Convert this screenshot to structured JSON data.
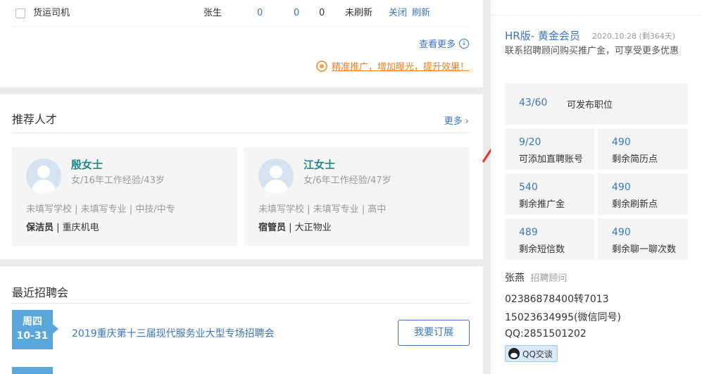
{
  "jobs": {
    "row": {
      "title": "货运司机",
      "contact": "张生",
      "n1": "0",
      "n2": "0",
      "n3": "0",
      "refresh_status": "未刷新",
      "action_close": "关闭",
      "action_refresh": "刷新"
    },
    "more_label": "查看更多",
    "promo_text": "精准推广，增加曝光，提升效果！"
  },
  "talent": {
    "title": "推荐人才",
    "more_label": "更多",
    "cards": [
      {
        "name": "殷女士",
        "info": "女/16年工作经验/43岁",
        "edu": "未填写学校 | 未填写专业 | 中技/中专",
        "job": "保洁员",
        "company": "| 重庆机电"
      },
      {
        "name": "江女士",
        "info": "女/6年工作经验/47岁",
        "edu": "未填写学校 | 未填写专业 | 高中",
        "job": "宿管员",
        "company": "| 大正物业"
      }
    ]
  },
  "fairs": {
    "title": "最近招聘会",
    "items": [
      {
        "weekday": "周四",
        "date": "10-31",
        "name": "2019重庆第十三届现代服务业大型专场招聘会",
        "button": "我要订展"
      }
    ]
  },
  "account": {
    "plan": "HR版- 黄金会员",
    "plan_date": "2020.10.28 (剩364天)",
    "desc": "联系招聘顾问购买推广金，可享受更多优惠",
    "positions": {
      "value": "43/60",
      "label": "可发布职位"
    },
    "stats": [
      {
        "value": "9/20",
        "label": "可添加直聘账号"
      },
      {
        "value": "490",
        "label": "剩余简历点"
      },
      {
        "value": "540",
        "label": "剩余推广金"
      },
      {
        "value": "490",
        "label": "剩余刷新点"
      },
      {
        "value": "489",
        "label": "剩余短信数"
      },
      {
        "value": "490",
        "label": "剩余聊一聊次数"
      }
    ]
  },
  "consultant": {
    "name": "张燕",
    "role": "招聘顾问",
    "phone": "02386878400转7013",
    "mobile": "15023634995(微信同号)",
    "qq": "QQ:2851501202",
    "qq_button": "QQ交谈"
  },
  "colors": {
    "link": "#3b76b8",
    "accent_orange": "#e8802f",
    "name_teal": "#1f8a8a",
    "date_blue": "#5aa8db",
    "arrow_red": "#e8312a"
  }
}
